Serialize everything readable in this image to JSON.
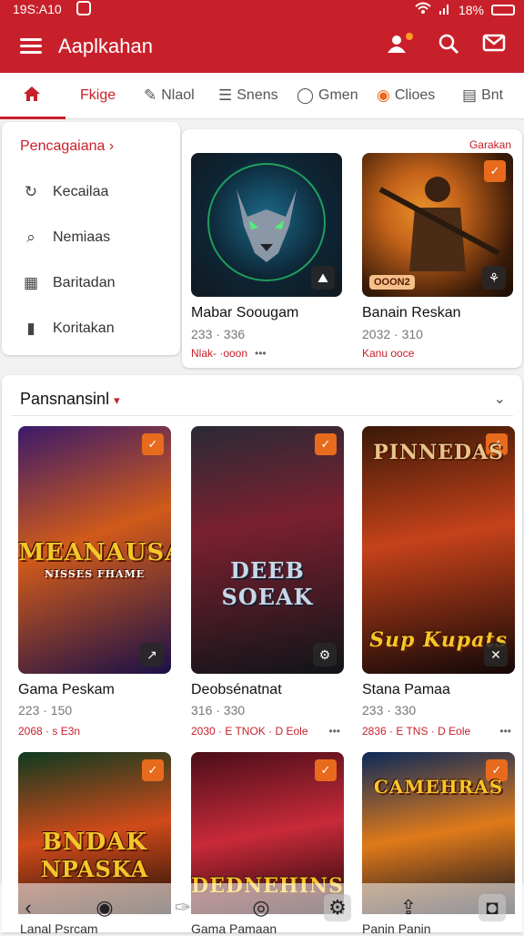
{
  "status": {
    "time": "19S:A10",
    "battery": "18%"
  },
  "appbar": {
    "title": "Aaplkahan",
    "menu_icon": "hamburger-icon",
    "actions": [
      "user-notify-icon",
      "search-icon",
      "mail-icon"
    ]
  },
  "tabs": [
    {
      "label": "",
      "icon": "home-icon"
    },
    {
      "label": "Fkige"
    },
    {
      "label": "Nlaol",
      "icon": "pen-icon"
    },
    {
      "label": "Snens",
      "icon": "sliders-icon"
    },
    {
      "label": "Gmen",
      "icon": "chat-icon"
    },
    {
      "label": "Clioes",
      "icon": "badge-icon"
    },
    {
      "label": "Bnt",
      "icon": "box-icon"
    }
  ],
  "side_menu": {
    "header": "Pencagaiana ›",
    "items": [
      {
        "label": "Kecailaa",
        "icon": "refresh-icon"
      },
      {
        "label": "Nemiaas",
        "icon": "search-icon"
      },
      {
        "label": "Baritadan",
        "icon": "grid-icon"
      },
      {
        "label": "Koritakan",
        "icon": "bookmark-icon"
      }
    ]
  },
  "featured": {
    "link": "Garakan",
    "cards": [
      {
        "title": "Mabar Soougam",
        "meta": "233 · 336",
        "meta2": "Nlak- ·ooon",
        "dots": "•••",
        "colors": [
          "#0d2535",
          "#1c6a8a",
          "#12181f"
        ]
      },
      {
        "title": "Banain Reskan",
        "meta": "2032 · 310",
        "meta2": "Kanu ooce",
        "dots": "",
        "overlay_label": "OOON2",
        "colors": [
          "#3b1b08",
          "#c6641a",
          "#1a0d05"
        ]
      }
    ]
  },
  "popular": {
    "header": "Pansnansinl",
    "header_marker": "▾",
    "games": [
      {
        "title": "Gama Peskam",
        "meta": "223 · 150",
        "meta2_left": "2068 · s E3n",
        "dots": "",
        "cover_text": [
          "MEANAUSA",
          "NISSES FHAME"
        ],
        "colors": [
          "#3a1a6a",
          "#d05a1a",
          "#1a1048"
        ]
      },
      {
        "title": "Deobsénatnat",
        "meta": "316 · 330",
        "meta2_left": "2030 · E TNOK · D  Eole",
        "dots": "•••",
        "cover_text": [
          "DEEB SOEAK"
        ],
        "colors": [
          "#2a2a35",
          "#7a2030",
          "#101418"
        ]
      },
      {
        "title": "Stana Pamaa",
        "meta": "233 · 330",
        "meta2_left": "2836 · E TNS · D  Eole",
        "dots": "•••",
        "cover_text": [
          "PINNEDAS",
          "Sup Kupats"
        ],
        "colors": [
          "#3a1808",
          "#c5421a",
          "#120808"
        ]
      },
      {
        "title": "Lanal Psrcam",
        "cover_text": [
          "BNDAK",
          "NPASKA"
        ],
        "colors": [
          "#0e3a20",
          "#d04a1a",
          "#1a0e08"
        ]
      },
      {
        "title": "Gama Pamaan",
        "cover_text": [
          "DEDNEHINS"
        ],
        "colors": [
          "#4a0e18",
          "#c82a3a",
          "#1a0608"
        ]
      },
      {
        "title": "Panin Panin",
        "cover_text": [
          "CAMEHRAS"
        ],
        "colors": [
          "#0c2a5a",
          "#e07a1a",
          "#0a1020"
        ]
      }
    ]
  },
  "bottom_nav": [
    "back-icon",
    "profile-icon",
    "pin-icon",
    "record-icon",
    "settings-icon",
    "share-icon",
    "camera-icon"
  ]
}
